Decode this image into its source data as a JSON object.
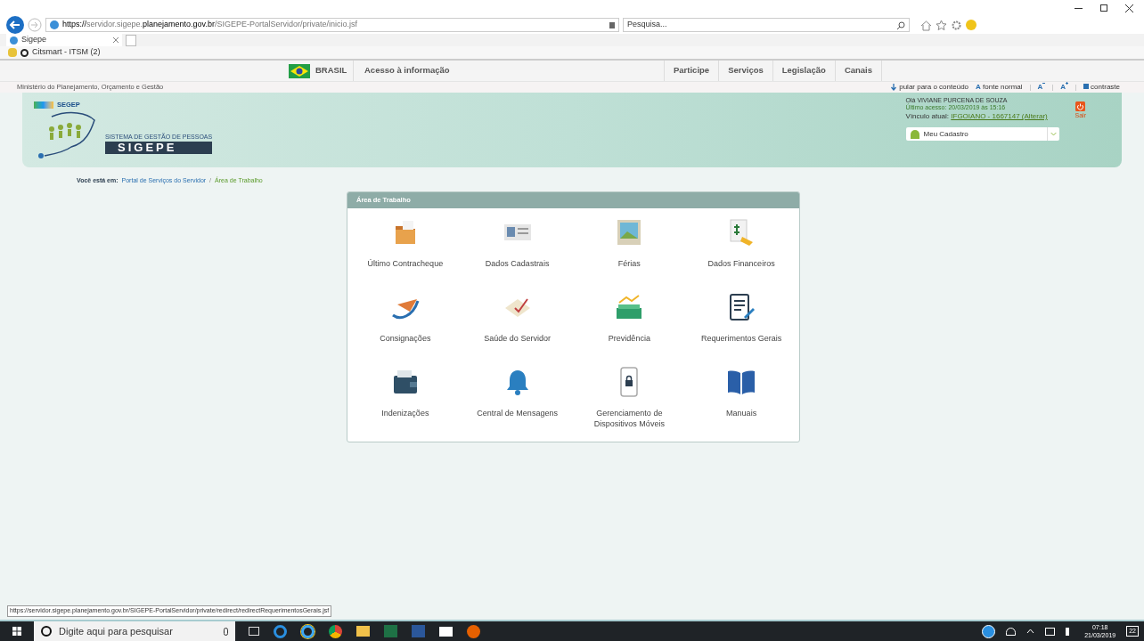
{
  "browser": {
    "url_host_pre": "https://servidor.sigepe.",
    "url_host_bold": "planejamento.gov.br",
    "url_path": "/SIGEPE-PortalServidor/private/inicio.jsf",
    "search_placeholder": "Pesquisa...",
    "tabs": [
      {
        "label": "Sigepe",
        "selected": true
      }
    ],
    "favorites": [
      {
        "label": "Citsmart - ITSM (2)"
      }
    ]
  },
  "gov_bar": {
    "country": "BRASIL",
    "access": "Acesso à informação",
    "links": [
      "Participe",
      "Serviços",
      "Legislação",
      "Canais"
    ]
  },
  "ministry": "Ministério do Planejamento, Orçamento e Gestão",
  "accessibility": {
    "skip": "pular para o conteúdo",
    "font_normal_icon": "A",
    "font_normal": "fonte normal",
    "decrease": "A",
    "increase": "A",
    "contrast": "contraste"
  },
  "header": {
    "org": "SEGEP",
    "system": "SISTEMA DE GESTÃO DE PESSOAS",
    "name": "SIGEPE",
    "greeting": "Olá VIVIANE PURCENA DE SOUZA",
    "last_access": "Último acesso: 20/03/2019 às 15:16",
    "link_label": "Vínculo atual:",
    "link_value": "IFGOIANO - 1667147 (Alterar)",
    "logout": "Sair",
    "menu": "Meu Cadastro"
  },
  "breadcrumb": {
    "label": "Você está em:",
    "items": [
      {
        "label": "Portal de Serviços do Servidor",
        "selected": false
      },
      {
        "label": "Área de Trabalho",
        "selected": true
      }
    ],
    "separator": "/"
  },
  "panel": {
    "title": "Área de Trabalho",
    "items": [
      {
        "label": "Último Contracheque"
      },
      {
        "label": "Dados Cadastrais"
      },
      {
        "label": "Férias"
      },
      {
        "label": "Dados Financeiros"
      },
      {
        "label": "Consignações"
      },
      {
        "label": "Saúde do Servidor"
      },
      {
        "label": "Previdência"
      },
      {
        "label": "Requerimentos Gerais"
      },
      {
        "label": "Indenizações"
      },
      {
        "label": "Central de Mensagens"
      },
      {
        "label": "Gerenciamento de Dispositivos Móveis"
      },
      {
        "label": "Manuais"
      }
    ]
  },
  "status_url": "https://servidor.sigepe.planejamento.gov.br/SIGEPE-PortalServidor/private/redirect/redirectRequerimentosGerais.jsf",
  "taskbar": {
    "search_placeholder": "Digite aqui para pesquisar",
    "time": "07:18",
    "date": "21/03/2019",
    "notifications": "22"
  }
}
